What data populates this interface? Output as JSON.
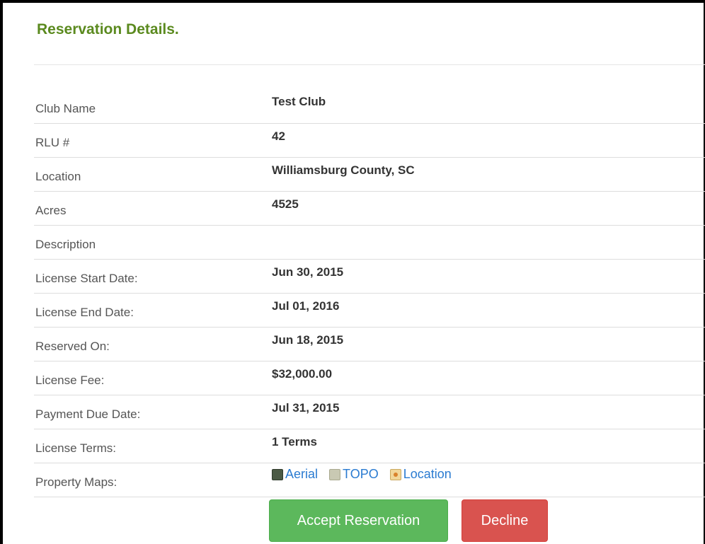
{
  "panel": {
    "title": "Reservation Details."
  },
  "details": [
    {
      "label": "Club Name",
      "value": "Test Club"
    },
    {
      "label": "RLU #",
      "value": "42"
    },
    {
      "label": "Location",
      "value": "Williamsburg County, SC"
    },
    {
      "label": "Acres",
      "value": "4525"
    },
    {
      "label": "Description",
      "value": ""
    },
    {
      "label": "License Start Date:",
      "value": "Jun 30, 2015"
    },
    {
      "label": "License End Date:",
      "value": "Jul 01, 2016"
    },
    {
      "label": "Reserved On:",
      "value": "Jun 18, 2015"
    },
    {
      "label": "License Fee:",
      "value": "$32,000.00"
    },
    {
      "label": "Payment Due Date:",
      "value": "Jul 31, 2015"
    },
    {
      "label": "License Terms:",
      "value": "1 Terms"
    }
  ],
  "property_maps": {
    "label": "Property Maps:",
    "links": [
      {
        "label": "Aerial",
        "icon": "aerial-map-icon"
      },
      {
        "label": "TOPO",
        "icon": "topo-map-icon"
      },
      {
        "label": "Location",
        "icon": "location-map-icon"
      }
    ]
  },
  "actions": {
    "accept_label": "Accept Reservation",
    "decline_label": "Decline",
    "accept_color": "#5cb85c",
    "decline_color": "#d9534f"
  },
  "colors": {
    "title": "#5b8a1f",
    "link": "#2a7bd1"
  }
}
